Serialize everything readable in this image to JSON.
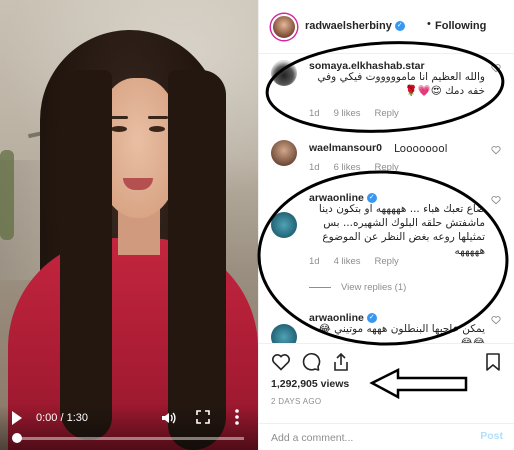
{
  "video": {
    "time": "0:00 / 1:30",
    "progress": 0.0,
    "icons": {
      "play": "play-icon",
      "volume": "volume-icon",
      "fullscreen": "fullscreen-icon",
      "more": "more-vertical-icon"
    }
  },
  "header": {
    "username": "radwaelsherbiny",
    "verified": true,
    "separator": "•",
    "follow_status": "Following"
  },
  "comments": [
    {
      "username": "somaya.elkhashab.star",
      "text": "والله العظيم انا ماموووووت فيكي وفي خفه دمك 😍💗🌹",
      "time": "1d",
      "likes": "9 likes",
      "reply": "Reply"
    },
    {
      "username": "waelmansour0",
      "text": "Loooooool",
      "time": "1d",
      "likes": "6 likes",
      "reply": "Reply"
    },
    {
      "username": "arwaonline",
      "verified": true,
      "text": "ضاع تعبك هباء ... هههههه او بتكون دينا ماشفتش حلقه البلوك الشهيره... بس تمثيلها روعه بغض النظر عن الموضوع هههههه",
      "time": "1d",
      "likes": "4 likes",
      "reply": "Reply",
      "view_replies": "View replies (1)"
    },
    {
      "username": "arwaonline",
      "verified": true,
      "text": "يمكن عاجبها البنطلون هههه موتيني 😂😂😂"
    }
  ],
  "actions": {
    "icons": [
      "heart-icon",
      "comment-icon",
      "share-icon",
      "bookmark-icon"
    ],
    "views": "1,292,905 views",
    "date": "2 DAYS AGO"
  },
  "add_comment": {
    "placeholder": "Add a comment...",
    "post_label": "Post"
  },
  "colors": {
    "accent_blue": "#3897f0",
    "post_disabled": "#b2dffc",
    "annotation": "#000000",
    "muted_text": "#8e8e8e"
  }
}
